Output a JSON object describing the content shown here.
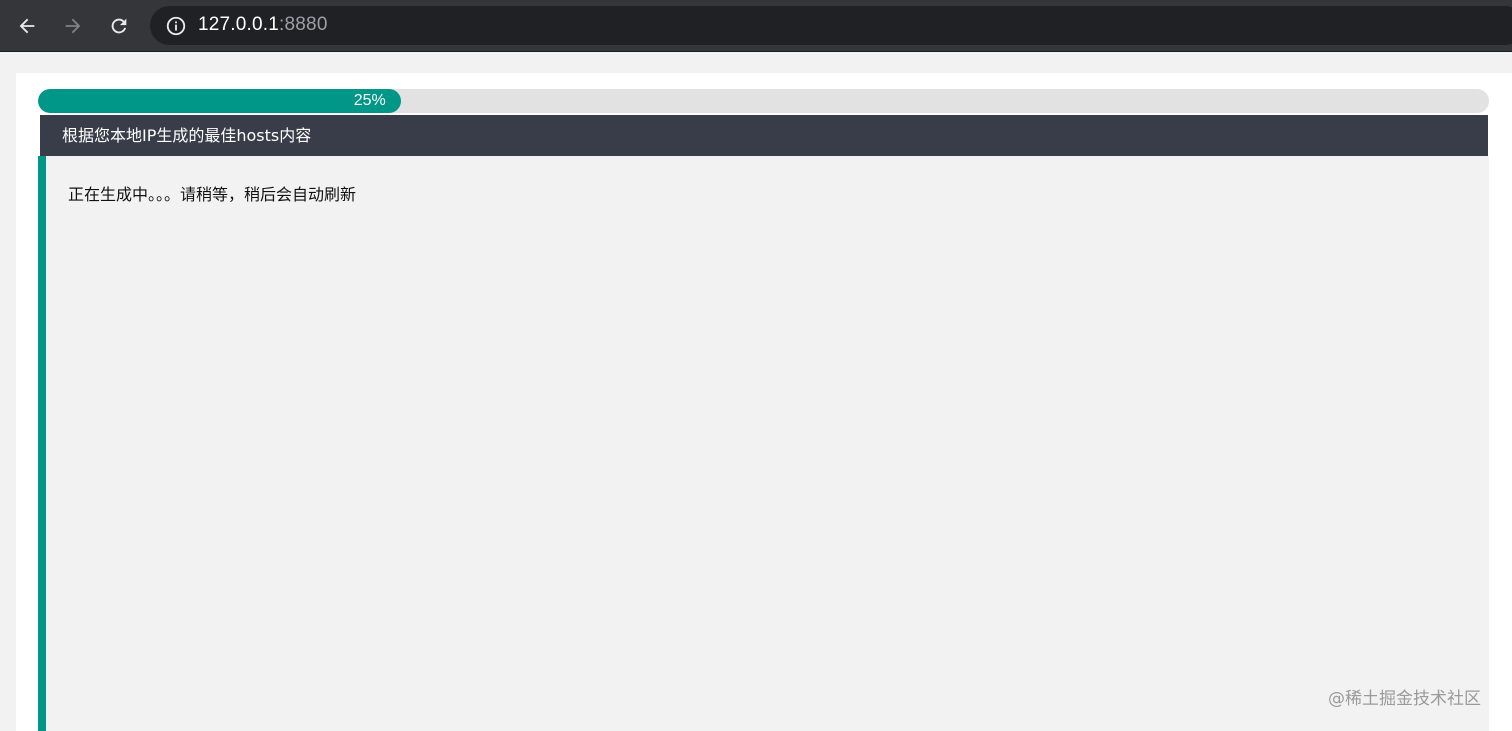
{
  "browser": {
    "url_host": "127.0.0.1",
    "url_port": ":8880",
    "back_icon": "arrow-left-icon",
    "forward_icon": "arrow-right-icon",
    "reload_icon": "reload-icon",
    "info_icon": "info-icon",
    "forward_disabled": true
  },
  "page": {
    "progress": {
      "percent": 25,
      "label": "25%",
      "color": "#009688"
    },
    "card": {
      "title": "根据您本地IP生成的最佳hosts内容",
      "header_color": "#393d49",
      "body_text": "正在生成中。。。请稍等，稍后会自动刷新"
    }
  },
  "watermark": "@稀土掘金技术社区"
}
